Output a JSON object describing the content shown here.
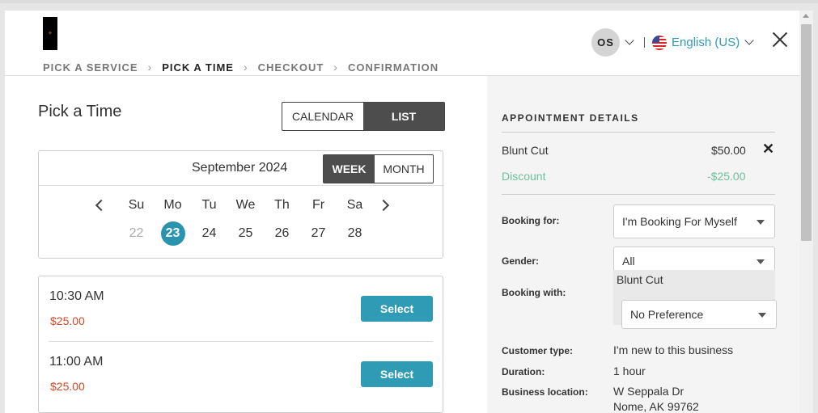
{
  "header": {
    "steps": [
      {
        "label": "PICK A SERVICE",
        "active": false
      },
      {
        "label": "PICK A TIME",
        "active": true
      },
      {
        "label": "CHECKOUT",
        "active": false
      },
      {
        "label": "CONFIRMATION",
        "active": false
      }
    ],
    "avatar_initials": "OS",
    "language": "English (US)"
  },
  "main": {
    "title": "Pick a Time",
    "view_toggle": {
      "calendar": "CALENDAR",
      "list": "LIST",
      "selected": "LIST"
    },
    "calendar": {
      "month": "September 2024",
      "week_label": "WEEK",
      "month_label": "MONTH",
      "selected_mode": "WEEK",
      "days": [
        {
          "name": "Su",
          "date": "22",
          "state": "past"
        },
        {
          "name": "Mo",
          "date": "23",
          "state": "selected"
        },
        {
          "name": "Tu",
          "date": "24",
          "state": "normal"
        },
        {
          "name": "We",
          "date": "25",
          "state": "normal"
        },
        {
          "name": "Th",
          "date": "26",
          "state": "normal"
        },
        {
          "name": "Fr",
          "date": "27",
          "state": "normal"
        },
        {
          "name": "Sa",
          "date": "28",
          "state": "normal"
        }
      ]
    },
    "slots": [
      {
        "time": "10:30 AM",
        "price": "$25.00",
        "button": "Select"
      },
      {
        "time": "11:00 AM",
        "price": "$25.00",
        "button": "Select"
      }
    ]
  },
  "details": {
    "title": "APPOINTMENT DETAILS",
    "service": {
      "name": "Blunt Cut",
      "price": "$50.00"
    },
    "discount": {
      "label": "Discount",
      "amount": "-$25.00"
    },
    "booking_for": {
      "label": "Booking for:",
      "value": "I'm Booking For Myself"
    },
    "gender": {
      "label": "Gender:",
      "value": "All"
    },
    "booking_with": {
      "label": "Booking with:",
      "service": "Blunt Cut",
      "value": "No Preference"
    },
    "customer_type": {
      "label": "Customer type:",
      "value": "I'm new to this business"
    },
    "duration": {
      "label": "Duration:",
      "value": "1 hour"
    },
    "location": {
      "label": "Business location:",
      "line1": "W Seppala Dr",
      "line2": "Nome, AK 99762"
    }
  },
  "colors": {
    "accent": "#2f9bb5",
    "price": "#d24a28",
    "discount": "#6cc29b",
    "dark": "#4d4d4d"
  }
}
